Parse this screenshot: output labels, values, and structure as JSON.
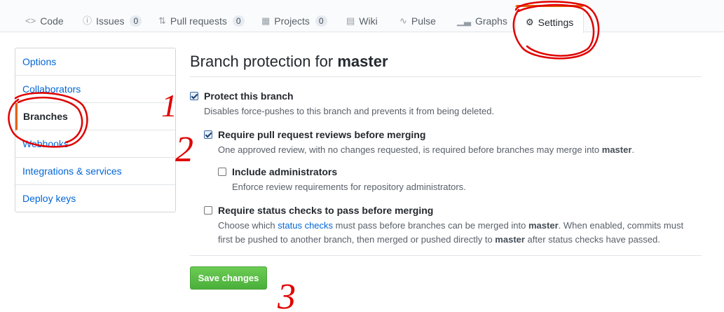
{
  "tabs": [
    {
      "label": "Code",
      "icon": "code-icon"
    },
    {
      "label": "Issues",
      "icon": "issue-icon",
      "count": "0"
    },
    {
      "label": "Pull requests",
      "icon": "pull-request-icon",
      "count": "0"
    },
    {
      "label": "Projects",
      "icon": "project-icon",
      "count": "0"
    },
    {
      "label": "Wiki",
      "icon": "book-icon"
    },
    {
      "label": "Pulse",
      "icon": "pulse-icon"
    },
    {
      "label": "Graphs",
      "icon": "graph-icon"
    },
    {
      "label": "Settings",
      "icon": "gear-icon",
      "selected": true
    }
  ],
  "sidebar": {
    "items": [
      {
        "label": "Options"
      },
      {
        "label": "Collaborators"
      },
      {
        "label": "Branches",
        "selected": true
      },
      {
        "label": "Webhooks"
      },
      {
        "label": "Integrations & services"
      },
      {
        "label": "Deploy keys"
      }
    ]
  },
  "main": {
    "title_prefix": "Branch protection for ",
    "title_branch": "master",
    "protect": {
      "label": "Protect this branch",
      "note": "Disables force-pushes to this branch and prevents it from being deleted.",
      "checked": true
    },
    "reviews": {
      "label": "Require pull request reviews before merging",
      "note_prefix": "One approved review, with no changes requested, is required before branches may merge into ",
      "note_branch": "master",
      "note_suffix": ".",
      "checked": true
    },
    "admins": {
      "label": "Include administrators",
      "note": "Enforce review requirements for repository administrators.",
      "checked": false
    },
    "status": {
      "label": "Require status checks to pass before merging",
      "note_1": "Choose which ",
      "note_link": "status checks",
      "note_2": " must pass before branches can be merged into ",
      "note_branch_1": "master",
      "note_3": ". When enabled, commits must",
      "note_4": "first be pushed to another branch, then merged or pushed directly to ",
      "note_branch_2": "master",
      "note_5": " after status checks have passed.",
      "checked": false
    },
    "save_label": "Save changes"
  },
  "annotations": {
    "color": "#e00000",
    "numbers": [
      "1",
      "2",
      "3"
    ]
  }
}
